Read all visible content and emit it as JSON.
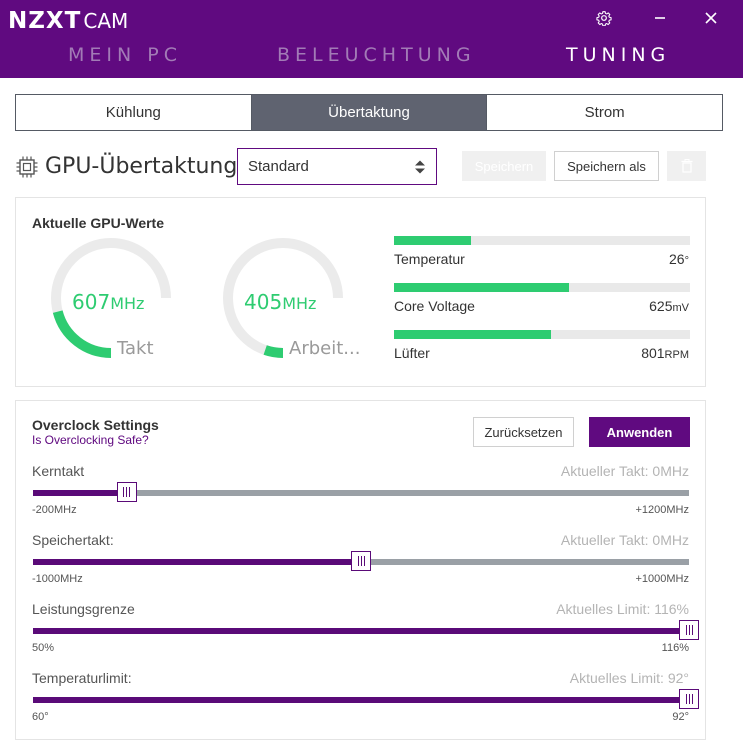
{
  "app": {
    "brand": "NZXT",
    "product": "CAM"
  },
  "icons": {
    "settings": "gear-icon",
    "minimize": "minimize-icon",
    "close": "close-icon",
    "chip": "chip-icon",
    "select_arrows": "sort-arrows-icon",
    "delete": "trash-icon"
  },
  "colors": {
    "header": "#600a80",
    "accent": "#600a80",
    "gauge": "#2ecc71",
    "tab_active": "#5f6370"
  },
  "nav": [
    {
      "label": "MEIN PC",
      "active": false
    },
    {
      "label": "BELEUCHTUNG",
      "active": false
    },
    {
      "label": "TUNING",
      "active": true
    }
  ],
  "tabs": [
    {
      "label": "Kühlung",
      "active": false
    },
    {
      "label": "Übertaktung",
      "active": true
    },
    {
      "label": "Strom",
      "active": false
    }
  ],
  "profile": {
    "title": "GPU-Übertaktung",
    "selected": "Standard",
    "save": "Speichern",
    "save_as": "Speichern als"
  },
  "current": {
    "title": "Aktuelle GPU-Werte",
    "gauges": [
      {
        "value": "607",
        "unit": "MHz",
        "label": "Takt",
        "fraction": 0.28
      },
      {
        "value": "405",
        "unit": "MHz",
        "label": "Arbeit...",
        "fraction": 0.07
      }
    ],
    "bars": [
      {
        "label": "Temperatur",
        "value": "26",
        "unit": "°",
        "percent": 26
      },
      {
        "label": "Core Voltage",
        "value": "625",
        "unit": "mV",
        "percent": 59
      },
      {
        "label": "Lüfter",
        "value": "801",
        "unit": "RPM",
        "percent": 53
      }
    ]
  },
  "overclock": {
    "title": "Overclock Settings",
    "link": "Is Overclocking Safe?",
    "reset": "Zurücksetzen",
    "apply": "Anwenden",
    "sliders": [
      {
        "name": "Kerntakt",
        "current": "Aktueller Takt: 0MHz",
        "min": "-200MHz",
        "max": "+1200MHz",
        "percent": 14.3
      },
      {
        "name": "Speichertakt:",
        "current": "Aktueller Takt: 0MHz",
        "min": "-1000MHz",
        "max": "+1000MHz",
        "percent": 50
      },
      {
        "name": "Leistungsgrenze",
        "current": "Aktuelles Limit: 116%",
        "min": "50%",
        "max": "116%",
        "percent": 100
      },
      {
        "name": "Temperaturlimit:",
        "current": "Aktuelles Limit: 92°",
        "min": "60°",
        "max": "92°",
        "percent": 100
      }
    ]
  }
}
